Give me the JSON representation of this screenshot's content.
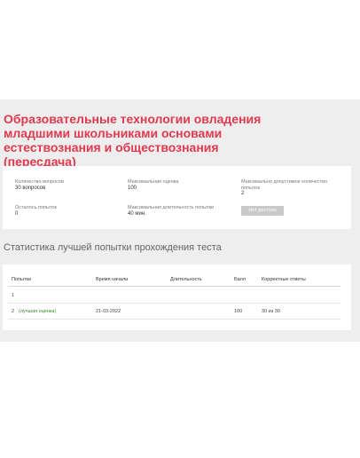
{
  "title": "Образовательные технологии овладения младшими школьниками основами естествознания и обществознания (пересдача)",
  "info": {
    "questions_label": "Количество вопросов",
    "questions_value": "30 вопросов",
    "max_score_label": "Максимальная оценка",
    "max_score_value": "100",
    "max_attempts_label": "Максимально допустимое количество попыток",
    "max_attempts_value": "2",
    "remaining_label": "Осталось попыток",
    "remaining_value": "0",
    "max_duration_label": "Максимальная длительность попытки",
    "max_duration_value": "40 мин.",
    "no_access_button": "Нет доступа"
  },
  "stats": {
    "title": "Статистика лучшей попытки прохождения теста",
    "columns": [
      "Попытки",
      "Время начала",
      "Длительность",
      "Балл",
      "Корректные ответы"
    ],
    "rows": [
      {
        "attempt": "1",
        "best_label": "",
        "start": "",
        "duration": "",
        "score": "",
        "correct": ""
      },
      {
        "attempt": "2",
        "best_label": "(лучшая оценка)",
        "start": "21-03-2022",
        "duration": "",
        "score": "100",
        "correct": "30 из 30"
      }
    ]
  },
  "colors": {
    "title": "#e03a4e",
    "best": "#3a8a2e",
    "background": "#eeeeee"
  }
}
